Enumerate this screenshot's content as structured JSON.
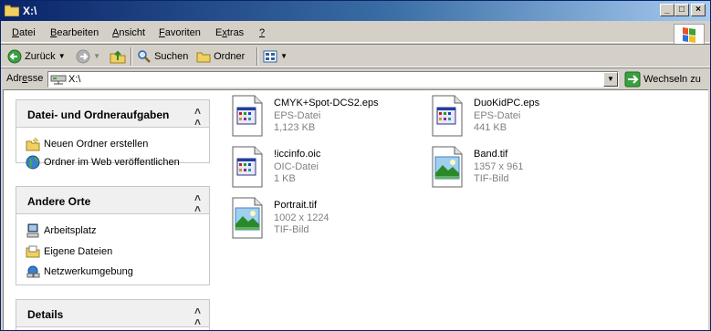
{
  "window": {
    "title": "X:\\"
  },
  "menu": [
    {
      "pre": "",
      "key": "D",
      "post": "atei"
    },
    {
      "pre": "",
      "key": "B",
      "post": "earbeiten"
    },
    {
      "pre": "",
      "key": "A",
      "post": "nsicht"
    },
    {
      "pre": "",
      "key": "F",
      "post": "avoriten"
    },
    {
      "pre": "E",
      "key": "x",
      "post": "tras"
    },
    {
      "pre": "",
      "key": "?",
      "post": ""
    }
  ],
  "toolbar": {
    "back": "Zurück",
    "search": "Suchen",
    "folders": "Ordner"
  },
  "address": {
    "label_pre": "Adr",
    "label_key": "e",
    "label_post": "sse",
    "value": "X:\\",
    "go": "Wechseln zu"
  },
  "panes": [
    {
      "title": "Datei- und Ordneraufgaben",
      "items": [
        "Neuen Ordner erstellen",
        "Ordner im Web veröffentlichen"
      ]
    },
    {
      "title": "Andere Orte",
      "items": [
        "Arbeitsplatz",
        "Eigene Dateien",
        "Netzwerkumgebung"
      ]
    },
    {
      "title": "Details",
      "items": []
    }
  ],
  "files": [
    {
      "name": "CMYK+Spot-DCS2.eps",
      "type": "EPS-Datei",
      "info": "1,123 KB",
      "icon": "generic-doc-icon"
    },
    {
      "name": "DuoKidPC.eps",
      "type": "EPS-Datei",
      "info": "441 KB",
      "icon": "generic-doc-icon"
    },
    {
      "name": "!iccinfo.oic",
      "type": "OIC-Datei",
      "info": "1 KB",
      "icon": "generic-doc-icon"
    },
    {
      "name": "Band.tif",
      "type": "1357 x 961",
      "info": "TIF-Bild",
      "icon": "image-file-icon"
    },
    {
      "name": "Portrait.tif",
      "type": "1002 x 1224",
      "info": "TIF-Bild",
      "icon": "image-file-icon"
    }
  ]
}
